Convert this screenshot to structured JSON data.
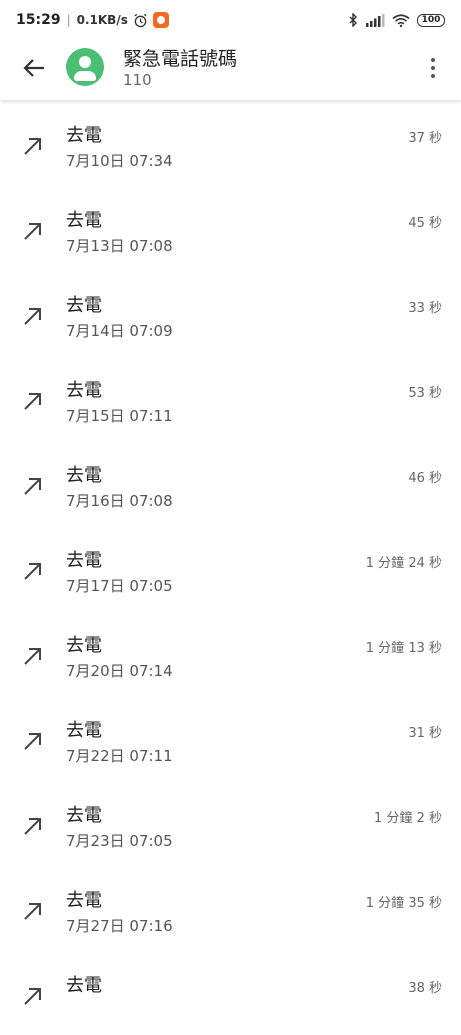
{
  "status_bar": {
    "time": "15:29",
    "network_speed": "0.1KB/s",
    "battery": "100"
  },
  "header": {
    "contact_name": "緊急電話號碼",
    "contact_number": "110"
  },
  "calls": [
    {
      "type": "去電",
      "datetime": "7月10日 07:34",
      "duration": "37 秒"
    },
    {
      "type": "去電",
      "datetime": "7月13日 07:08",
      "duration": "45 秒"
    },
    {
      "type": "去電",
      "datetime": "7月14日 07:09",
      "duration": "33 秒"
    },
    {
      "type": "去電",
      "datetime": "7月15日 07:11",
      "duration": "53 秒"
    },
    {
      "type": "去電",
      "datetime": "7月16日 07:08",
      "duration": "46 秒"
    },
    {
      "type": "去電",
      "datetime": "7月17日 07:05",
      "duration": "1 分鐘 24 秒"
    },
    {
      "type": "去電",
      "datetime": "7月20日 07:14",
      "duration": "1 分鐘 13 秒"
    },
    {
      "type": "去電",
      "datetime": "7月22日 07:11",
      "duration": "31 秒"
    },
    {
      "type": "去電",
      "datetime": "7月23日 07:05",
      "duration": "1 分鐘 2 秒"
    },
    {
      "type": "去電",
      "datetime": "7月27日 07:16",
      "duration": "1 分鐘 35 秒"
    },
    {
      "type": "去電",
      "datetime": "",
      "duration": "38 秒"
    }
  ],
  "icons": {
    "back": "arrow-left-icon",
    "more": "more-vert-icon",
    "outgoing": "outgoing-call-arrow-icon"
  },
  "colors": {
    "avatar": "#4bbf73",
    "app_badge": "#f26a21"
  }
}
